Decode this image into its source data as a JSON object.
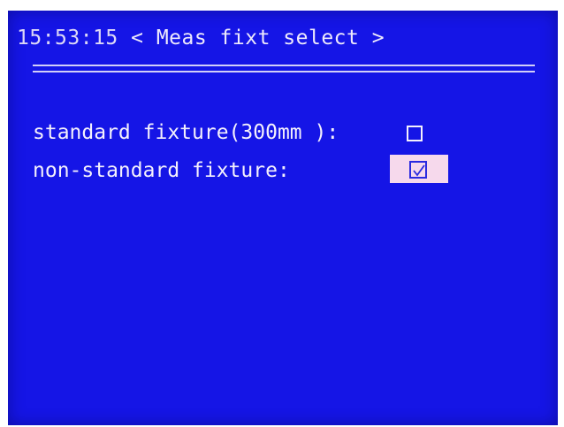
{
  "header": {
    "time": "15:53:15",
    "title": " < Meas fixt select >"
  },
  "options": [
    {
      "label": "standard fixture(300mm ):",
      "checked": false
    },
    {
      "label": "non-standard fixture:",
      "checked": true
    }
  ],
  "colors": {
    "screen_bg": "#1515e6",
    "text": "#f2eefc",
    "selected_bg": "#f6d9ec"
  }
}
